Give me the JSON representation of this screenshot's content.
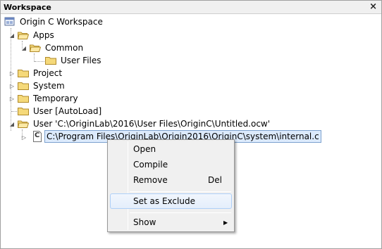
{
  "window": {
    "title": "Workspace",
    "close_glyph": "×"
  },
  "tree": {
    "root": "Origin C Workspace",
    "apps": "Apps",
    "common": "Common",
    "user_files": "User Files",
    "project": "Project",
    "system": "System",
    "temporary": "Temporary",
    "user_autoload": "User  [AutoLoad]",
    "user_workspace": "User 'C:\\OriginLab\\2016\\User Files\\OriginC\\Untitled.ocw'",
    "file": "C:\\Program Files\\OriginLab\\Origin2016\\OriginC\\system\\internal.c",
    "file_icon_letter": "C"
  },
  "context_menu": {
    "open": "Open",
    "compile": "Compile",
    "remove": "Remove",
    "remove_shortcut": "Del",
    "set_as_exclude": "Set as Exclude",
    "show": "Show"
  },
  "colors": {
    "folder_fill": "#f5d97a",
    "folder_stroke": "#b08a2a",
    "selection": "#dceafc",
    "menu_hover_border": "#aecff7"
  }
}
